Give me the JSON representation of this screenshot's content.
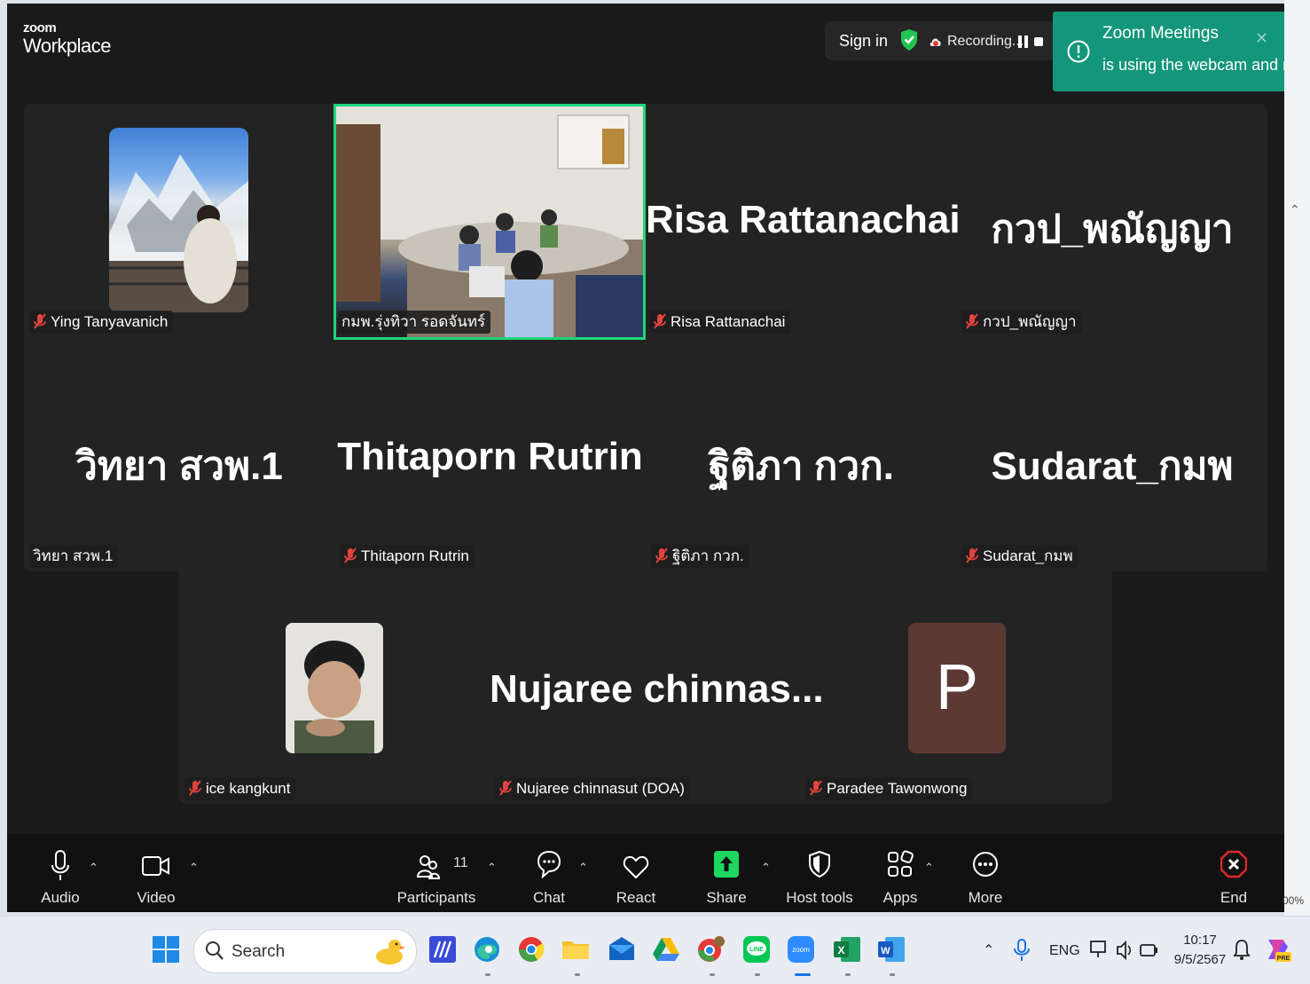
{
  "app": {
    "logo_small": "zoom",
    "logo_big": "Workplace"
  },
  "header": {
    "sign_in": "Sign in",
    "recording_text": "Recording..."
  },
  "notification": {
    "title": "Zoom Meetings",
    "message": "is using the webcam and mic"
  },
  "participants": [
    {
      "display": "",
      "label": "Ying Tanyavanich",
      "video": true,
      "muted": true
    },
    {
      "display": "",
      "label": "กมพ.รุ่งทิวา รอดจันทร์",
      "video": true,
      "muted": false,
      "active_speaker": true
    },
    {
      "display": "Risa Rattanachai",
      "label": "Risa Rattanachai",
      "video": false,
      "muted": true
    },
    {
      "display": "กวป_พณัญญา",
      "label": "กวป_พณัญญา",
      "video": false,
      "muted": true
    },
    {
      "display": "วิทยา สวพ.1",
      "label": "วิทยา สวพ.1",
      "video": false,
      "muted": false
    },
    {
      "display": "Thitaporn Rutrin",
      "label": "Thitaporn Rutrin",
      "video": false,
      "muted": true
    },
    {
      "display": "ฐิติภา กวก.",
      "label": "ฐิติภา กวก.",
      "video": false,
      "muted": true
    },
    {
      "display": "Sudarat_กมพ",
      "label": "Sudarat_กมพ",
      "video": false,
      "muted": true
    },
    {
      "display": "",
      "label": "ice kangkunt",
      "video": true,
      "muted": true
    },
    {
      "display": "Nujaree  chinnas...",
      "label": "Nujaree chinnasut (DOA)",
      "video": false,
      "muted": true
    },
    {
      "display": "P",
      "label": "Paradee Tawonwong",
      "video": false,
      "muted": true,
      "avatar_color": "#5c3a33"
    }
  ],
  "toolbar": {
    "audio": "Audio",
    "video": "Video",
    "participants": "Participants",
    "participant_count": "11",
    "chat": "Chat",
    "react": "React",
    "share": "Share",
    "host_tools": "Host tools",
    "apps": "Apps",
    "more": "More",
    "end": "End"
  },
  "side": {
    "zoom_percent": "00%"
  },
  "taskbar": {
    "search_placeholder": "Search",
    "language": "ENG",
    "time": "10:17",
    "date": "9/5/2567",
    "apps": [
      "windows-start",
      "search",
      "code-editor",
      "edge",
      "chrome",
      "file-explorer",
      "mail",
      "google-drive",
      "chrome-profile",
      "line",
      "zoom",
      "excel",
      "word"
    ]
  },
  "colors": {
    "active_speaker_border": "#1fd67a",
    "notification_bg": "#13967a",
    "share_green": "#1ed760",
    "end_red": "#e02828",
    "muted_red": "#e0443e"
  }
}
